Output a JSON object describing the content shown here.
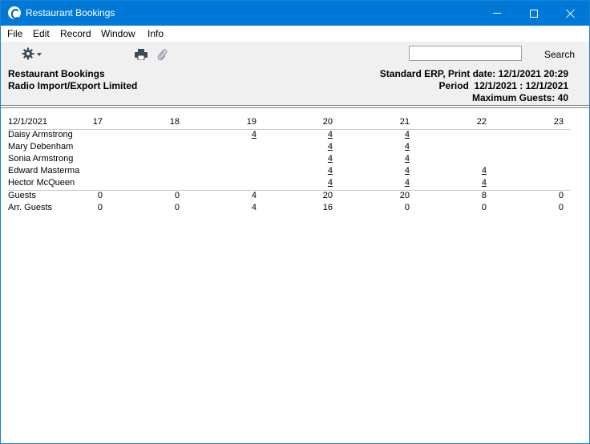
{
  "window": {
    "title": "Restaurant Bookings"
  },
  "menu": [
    "File",
    "Edit",
    "Record",
    "Window",
    "Info"
  ],
  "toolbar": {
    "search_value": "",
    "search_label": "Search"
  },
  "report_header": {
    "title": "Restaurant Bookings",
    "company": "Radio Import/Export Limited",
    "print_line": "Standard ERP, Print date: 12/1/2021 20:29",
    "period": "Period  12/1/2021 : 12/1/2021",
    "max_guests": "Maximum Guests: 40"
  },
  "table": {
    "date": "12/1/2021",
    "hours": [
      "17",
      "18",
      "19",
      "20",
      "21",
      "22",
      "23"
    ],
    "bookings": [
      {
        "name": "Daisy Armstrong",
        "cells": [
          "",
          "",
          "4",
          "4",
          "4",
          "",
          ""
        ]
      },
      {
        "name": "Mary Debenham",
        "cells": [
          "",
          "",
          "",
          "4",
          "4",
          "",
          ""
        ]
      },
      {
        "name": "Sonia Armstrong",
        "cells": [
          "",
          "",
          "",
          "4",
          "4",
          "",
          ""
        ]
      },
      {
        "name": "Edward Masterma",
        "cells": [
          "",
          "",
          "",
          "4",
          "4",
          "4",
          ""
        ]
      },
      {
        "name": "Hector McQueen",
        "cells": [
          "",
          "",
          "",
          "4",
          "4",
          "4",
          ""
        ]
      }
    ],
    "totals": [
      {
        "name": "Guests",
        "cells": [
          "0",
          "0",
          "4",
          "20",
          "20",
          "8",
          "0"
        ]
      },
      {
        "name": "Arr. Guests",
        "cells": [
          "0",
          "0",
          "4",
          "16",
          "0",
          "0",
          "0"
        ]
      }
    ]
  }
}
